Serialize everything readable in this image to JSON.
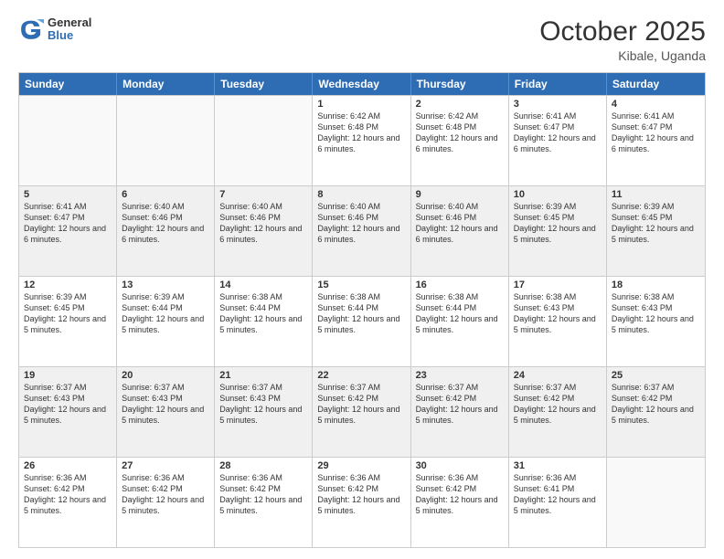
{
  "header": {
    "logo_general": "General",
    "logo_blue": "Blue",
    "month_title": "October 2025",
    "location": "Kibale, Uganda"
  },
  "weekdays": [
    "Sunday",
    "Monday",
    "Tuesday",
    "Wednesday",
    "Thursday",
    "Friday",
    "Saturday"
  ],
  "rows": [
    [
      {
        "day": "",
        "empty": true
      },
      {
        "day": "",
        "empty": true
      },
      {
        "day": "",
        "empty": true
      },
      {
        "day": "1",
        "sunrise": "6:42 AM",
        "sunset": "6:48 PM",
        "daylight": "12 hours and 6 minutes."
      },
      {
        "day": "2",
        "sunrise": "6:42 AM",
        "sunset": "6:48 PM",
        "daylight": "12 hours and 6 minutes."
      },
      {
        "day": "3",
        "sunrise": "6:41 AM",
        "sunset": "6:47 PM",
        "daylight": "12 hours and 6 minutes."
      },
      {
        "day": "4",
        "sunrise": "6:41 AM",
        "sunset": "6:47 PM",
        "daylight": "12 hours and 6 minutes."
      }
    ],
    [
      {
        "day": "5",
        "sunrise": "6:41 AM",
        "sunset": "6:47 PM",
        "daylight": "12 hours and 6 minutes."
      },
      {
        "day": "6",
        "sunrise": "6:40 AM",
        "sunset": "6:46 PM",
        "daylight": "12 hours and 6 minutes."
      },
      {
        "day": "7",
        "sunrise": "6:40 AM",
        "sunset": "6:46 PM",
        "daylight": "12 hours and 6 minutes."
      },
      {
        "day": "8",
        "sunrise": "6:40 AM",
        "sunset": "6:46 PM",
        "daylight": "12 hours and 6 minutes."
      },
      {
        "day": "9",
        "sunrise": "6:40 AM",
        "sunset": "6:46 PM",
        "daylight": "12 hours and 6 minutes."
      },
      {
        "day": "10",
        "sunrise": "6:39 AM",
        "sunset": "6:45 PM",
        "daylight": "12 hours and 5 minutes."
      },
      {
        "day": "11",
        "sunrise": "6:39 AM",
        "sunset": "6:45 PM",
        "daylight": "12 hours and 5 minutes."
      }
    ],
    [
      {
        "day": "12",
        "sunrise": "6:39 AM",
        "sunset": "6:45 PM",
        "daylight": "12 hours and 5 minutes."
      },
      {
        "day": "13",
        "sunrise": "6:39 AM",
        "sunset": "6:44 PM",
        "daylight": "12 hours and 5 minutes."
      },
      {
        "day": "14",
        "sunrise": "6:38 AM",
        "sunset": "6:44 PM",
        "daylight": "12 hours and 5 minutes."
      },
      {
        "day": "15",
        "sunrise": "6:38 AM",
        "sunset": "6:44 PM",
        "daylight": "12 hours and 5 minutes."
      },
      {
        "day": "16",
        "sunrise": "6:38 AM",
        "sunset": "6:44 PM",
        "daylight": "12 hours and 5 minutes."
      },
      {
        "day": "17",
        "sunrise": "6:38 AM",
        "sunset": "6:43 PM",
        "daylight": "12 hours and 5 minutes."
      },
      {
        "day": "18",
        "sunrise": "6:38 AM",
        "sunset": "6:43 PM",
        "daylight": "12 hours and 5 minutes."
      }
    ],
    [
      {
        "day": "19",
        "sunrise": "6:37 AM",
        "sunset": "6:43 PM",
        "daylight": "12 hours and 5 minutes."
      },
      {
        "day": "20",
        "sunrise": "6:37 AM",
        "sunset": "6:43 PM",
        "daylight": "12 hours and 5 minutes."
      },
      {
        "day": "21",
        "sunrise": "6:37 AM",
        "sunset": "6:43 PM",
        "daylight": "12 hours and 5 minutes."
      },
      {
        "day": "22",
        "sunrise": "6:37 AM",
        "sunset": "6:42 PM",
        "daylight": "12 hours and 5 minutes."
      },
      {
        "day": "23",
        "sunrise": "6:37 AM",
        "sunset": "6:42 PM",
        "daylight": "12 hours and 5 minutes."
      },
      {
        "day": "24",
        "sunrise": "6:37 AM",
        "sunset": "6:42 PM",
        "daylight": "12 hours and 5 minutes."
      },
      {
        "day": "25",
        "sunrise": "6:37 AM",
        "sunset": "6:42 PM",
        "daylight": "12 hours and 5 minutes."
      }
    ],
    [
      {
        "day": "26",
        "sunrise": "6:36 AM",
        "sunset": "6:42 PM",
        "daylight": "12 hours and 5 minutes."
      },
      {
        "day": "27",
        "sunrise": "6:36 AM",
        "sunset": "6:42 PM",
        "daylight": "12 hours and 5 minutes."
      },
      {
        "day": "28",
        "sunrise": "6:36 AM",
        "sunset": "6:42 PM",
        "daylight": "12 hours and 5 minutes."
      },
      {
        "day": "29",
        "sunrise": "6:36 AM",
        "sunset": "6:42 PM",
        "daylight": "12 hours and 5 minutes."
      },
      {
        "day": "30",
        "sunrise": "6:36 AM",
        "sunset": "6:42 PM",
        "daylight": "12 hours and 5 minutes."
      },
      {
        "day": "31",
        "sunrise": "6:36 AM",
        "sunset": "6:41 PM",
        "daylight": "12 hours and 5 minutes."
      },
      {
        "day": "",
        "empty": true
      }
    ]
  ]
}
